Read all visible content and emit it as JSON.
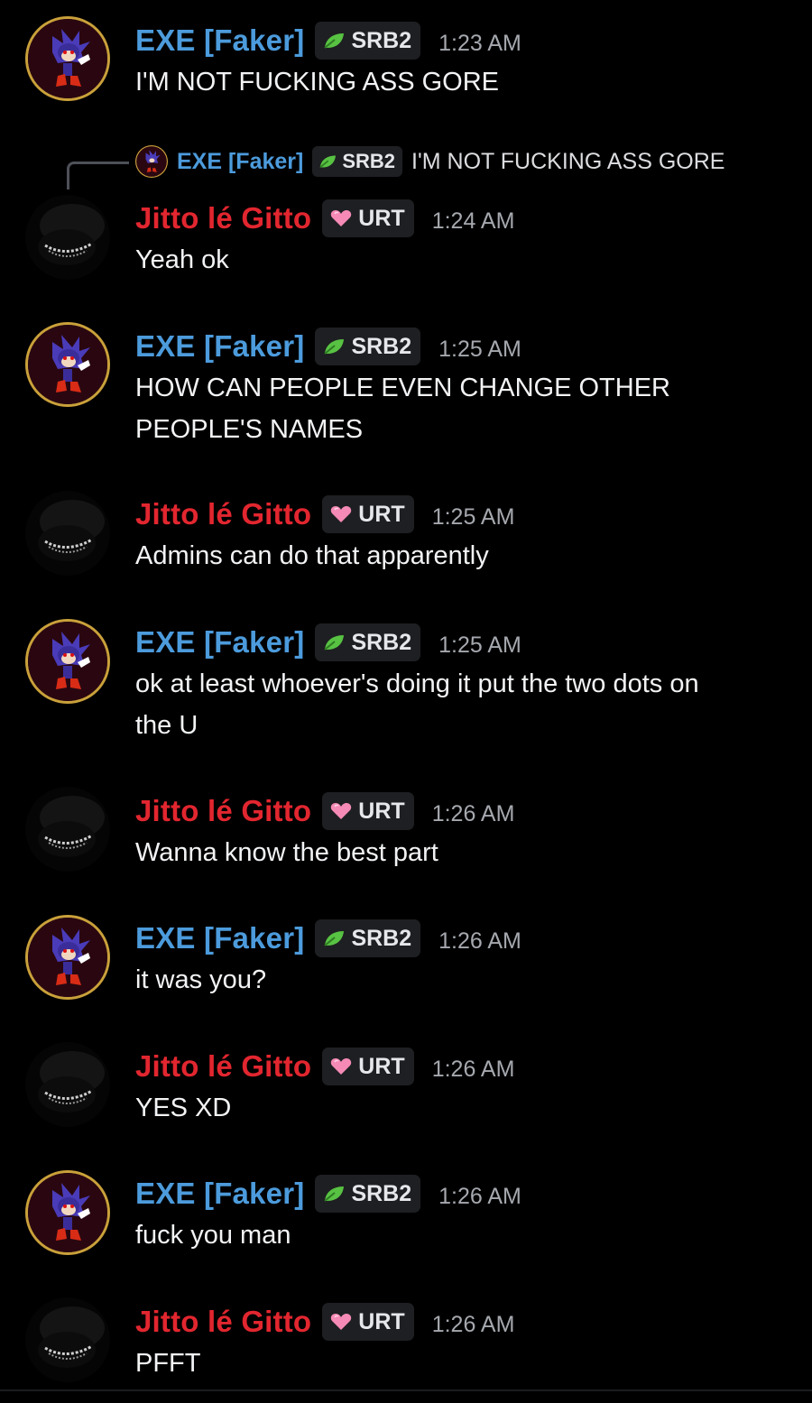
{
  "colors": {
    "exe_name": "#4c9bdc",
    "jitto_name": "#e2262f",
    "tag_bg": "#1e1f22",
    "timestamp": "#a5a8ae",
    "background": "#000000"
  },
  "users": {
    "exe": {
      "name": "EXE [Faker]",
      "tag": "SRB2",
      "tag_icon": "leaf-icon"
    },
    "jitto": {
      "name": "Jitto lé Gitto",
      "tag": "URT",
      "tag_icon": "heart-icon"
    }
  },
  "reply": {
    "author": "EXE [Faker]",
    "tag": "SRB2",
    "text": "I'M NOT FUCKING ASS GORE"
  },
  "messages": [
    {
      "author": "EXE [Faker]",
      "tag": "SRB2",
      "time": "1:23 AM",
      "text": "I'M NOT FUCKING ASS GORE"
    },
    {
      "author": "Jitto lé Gitto",
      "tag": "URT",
      "time": "1:24 AM",
      "text": "Yeah ok"
    },
    {
      "author": "EXE [Faker]",
      "tag": "SRB2",
      "time": "1:25 AM",
      "text_lines": [
        "HOW CAN PEOPLE EVEN CHANGE OTHER",
        "PEOPLE'S NAMES"
      ]
    },
    {
      "author": "Jitto lé Gitto",
      "tag": "URT",
      "time": "1:25 AM",
      "text": "Admins can do that apparently"
    },
    {
      "author": "EXE [Faker]",
      "tag": "SRB2",
      "time": "1:25 AM",
      "text_lines": [
        "ok at least whoever's doing it put the two dots on",
        "the U"
      ]
    },
    {
      "author": "Jitto lé Gitto",
      "tag": "URT",
      "time": "1:26 AM",
      "text": "Wanna know the best part"
    },
    {
      "author": "EXE [Faker]",
      "tag": "SRB2",
      "time": "1:26 AM",
      "text": "it was you?"
    },
    {
      "author": "Jitto lé Gitto",
      "tag": "URT",
      "time": "1:26 AM",
      "text": "YES XD"
    },
    {
      "author": "EXE [Faker]",
      "tag": "SRB2",
      "time": "1:26 AM",
      "text": "fuck you man"
    },
    {
      "author": "Jitto lé Gitto",
      "tag": "URT",
      "time": "1:26 AM",
      "text": "PFFT"
    }
  ]
}
